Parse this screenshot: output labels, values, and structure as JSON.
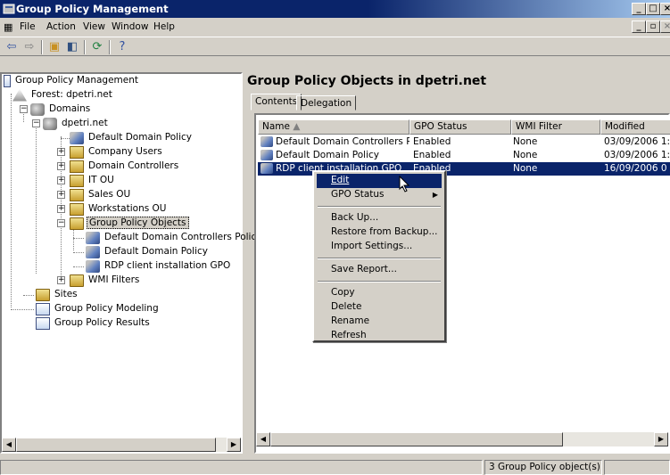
{
  "window": {
    "title": "Group Policy Management"
  },
  "menu": [
    "File",
    "Action",
    "View",
    "Window",
    "Help"
  ],
  "toolbar": {
    "icons": [
      "back-arrow-icon",
      "forward-arrow-icon",
      "up-folder-icon",
      "show-hide-tree-icon",
      "refresh-icon",
      "help-icon"
    ]
  },
  "tree": {
    "root": "Group Policy Management",
    "forest": "Forest: dpetri.net",
    "domains": "Domains",
    "domain": "dpetri.net",
    "default_domain_policy": "Default Domain Policy",
    "company_users": "Company Users",
    "domain_controllers": "Domain Controllers",
    "it_ou": "IT OU",
    "sales_ou": "Sales OU",
    "workstations_ou": "Workstations OU",
    "gpo_container": "Group Policy Objects",
    "gpo_1": "Default Domain Controllers Policy",
    "gpo_2": "Default Domain Policy",
    "gpo_3": "RDP client installation GPO",
    "wmi_filters": "WMI Filters",
    "sites": "Sites",
    "modeling": "Group Policy Modeling",
    "results": "Group Policy Results"
  },
  "right": {
    "title": "Group Policy Objects in dpetri.net",
    "tabs": [
      "Contents",
      "Delegation"
    ],
    "columns": [
      "Name",
      "GPO Status",
      "WMI Filter",
      "Modified"
    ],
    "rows": [
      {
        "name": "Default Domain Controllers P...",
        "status": "Enabled",
        "wmi": "None",
        "modified": "03/09/2006 1:"
      },
      {
        "name": "Default Domain Policy",
        "status": "Enabled",
        "wmi": "None",
        "modified": "03/09/2006 1:"
      },
      {
        "name": "RDP client installation GPO",
        "status": "Enabled",
        "wmi": "None",
        "modified": "16/09/2006 0"
      }
    ]
  },
  "context_menu": {
    "items": [
      "Edit",
      "GPO Status",
      "Back Up...",
      "Restore from Backup...",
      "Import Settings...",
      "Save Report...",
      "Copy",
      "Delete",
      "Rename",
      "Refresh"
    ]
  },
  "status": {
    "count": "3 Group Policy object(s)"
  }
}
